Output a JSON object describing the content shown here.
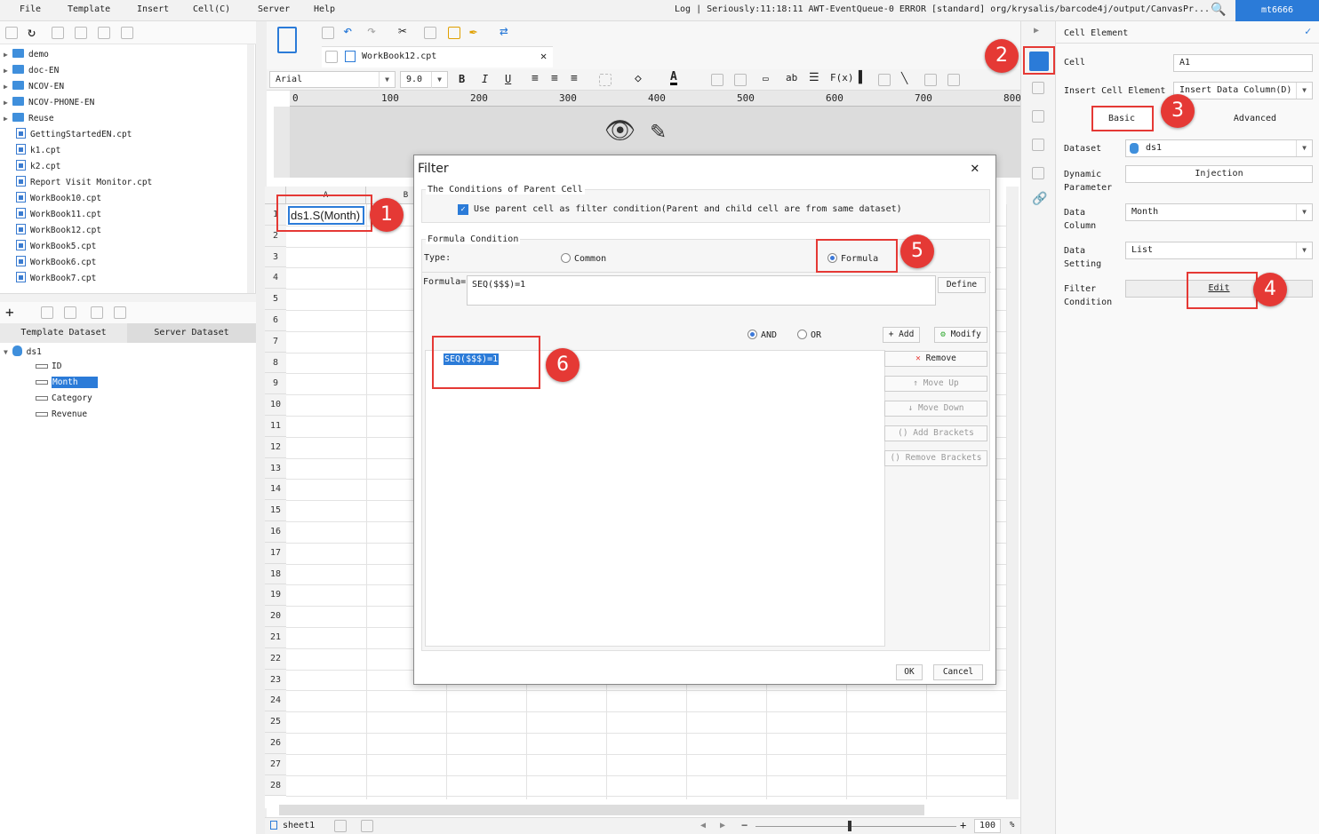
{
  "menu": [
    "File",
    "Template",
    "Insert",
    "Cell(C)",
    "Server",
    "Help"
  ],
  "log_text": "Log | Seriously:11:18:11 AWT-EventQueue-0 ERROR [standard] org/krysalis/barcode4j/output/CanvasPr...",
  "user": "mt6666",
  "tree": {
    "folders": [
      "demo",
      "doc-EN",
      "NCOV-EN",
      "NCOV-PHONE-EN",
      "Reuse"
    ],
    "files": [
      "GettingStartedEN.cpt",
      "k1.cpt",
      "k2.cpt",
      "Report Visit Monitor.cpt",
      "WorkBook10.cpt",
      "WorkBook11.cpt",
      "WorkBook12.cpt",
      "WorkBook5.cpt",
      "WorkBook6.cpt",
      "WorkBook7.cpt"
    ]
  },
  "dataset_tabs": [
    "Template Dataset",
    "Server Dataset"
  ],
  "dataset": {
    "name": "ds1",
    "fields": [
      "ID",
      "Month",
      "Category",
      "Revenue"
    ]
  },
  "workbook_tab": "WorkBook12.cpt",
  "format": {
    "font": "Arial",
    "size": "9.0"
  },
  "ruler": [
    "0",
    "100",
    "200",
    "300",
    "400",
    "500",
    "600",
    "700",
    "800"
  ],
  "grid": {
    "cols": [
      "A",
      "B"
    ],
    "rows": [
      "1",
      "2",
      "3",
      "4",
      "5",
      "6",
      "7",
      "8",
      "9",
      "10",
      "11",
      "12",
      "13",
      "14",
      "15",
      "16",
      "17",
      "18",
      "19",
      "20",
      "21",
      "22",
      "23",
      "24",
      "25",
      "26",
      "27",
      "28"
    ],
    "a1": "ds1.S(Month)"
  },
  "sheet_tab": "sheet1",
  "zoom": "100",
  "zoom_unit": "%",
  "panel": {
    "title": "Cell Element",
    "cell_label": "Cell",
    "cell_value": "A1",
    "insert_label": "Insert Cell Element",
    "insert_value": "Insert Data Column(D)",
    "tab_basic": "Basic",
    "tab_advanced": "Advanced",
    "dataset_label": "Dataset",
    "dataset_value": "ds1",
    "dynparam_label1": "Dynamic",
    "dynparam_label2": "Parameter",
    "dynparam_value": "Injection",
    "datacol_label1": "Data",
    "datacol_label2": "Column",
    "datacol_value": "Month",
    "datasetting_label1": "Data",
    "datasetting_label2": "Setting",
    "datasetting_value": "List",
    "filter_label1": "Filter",
    "filter_label2": "Condition",
    "filter_value": "Edit"
  },
  "dialog": {
    "title": "Filter",
    "parent_group": "The Conditions of Parent Cell",
    "parent_check": "Use parent cell as filter condition(Parent and child cell are from same dataset)",
    "formula_group": "Formula Condition",
    "type_label": "Type:",
    "type_common": "Common",
    "type_formula": "Formula",
    "formula_label": "Formula=",
    "formula_value": "SEQ($$$)=1",
    "define": "Define",
    "and": "AND",
    "or": "OR",
    "add": "Add",
    "modify": "Modify",
    "remove": "Remove",
    "move_up": "Move Up",
    "move_down": "Move Down",
    "add_brackets": "Add Brackets",
    "remove_brackets": "Remove Brackets",
    "list_item": "SEQ($$$)=1",
    "ok": "OK",
    "cancel": "Cancel"
  },
  "badges": [
    "1",
    "2",
    "3",
    "4",
    "5",
    "6"
  ]
}
